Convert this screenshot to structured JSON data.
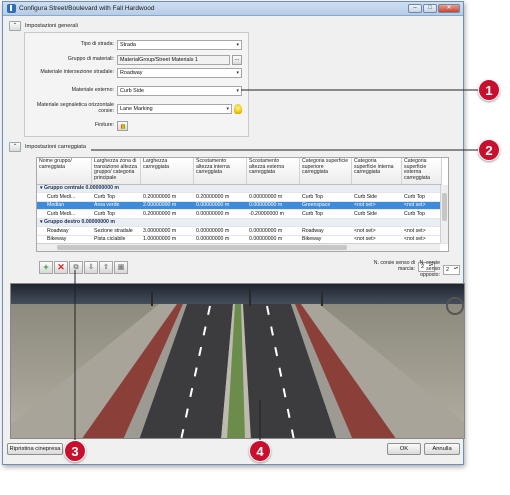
{
  "window": {
    "title": "Configura Street/Boulevard with Fall Hardwood",
    "minimize": "–",
    "maximize": "□",
    "close": "✕"
  },
  "general": {
    "header": "Impostazioni generali",
    "collapse_glyph": "⌃",
    "fields": [
      {
        "label": "Tipo di strada:",
        "value": "Strada"
      },
      {
        "label": "Gruppo di materiali:",
        "value": "MaterialGroup/Street Materials 1",
        "button": "..."
      },
      {
        "label": "Materiale intersezione stradale:",
        "value": "Roadway"
      },
      {
        "label": "Materiale esterno:",
        "value": "Curb Side"
      },
      {
        "label": "Materiale segnaletica orizzontale corsie:",
        "value": "Lane Marking"
      },
      {
        "label": "Finiture:",
        "value": ""
      }
    ]
  },
  "roadway": {
    "header": "Impostazioni carreggiata",
    "collapse_glyph": "⌃",
    "columns": [
      "Nome gruppo/ carreggiata",
      "Larghezza zona di transizione altezza gruppo/ categoria principale",
      "Larghezza carreggiata",
      "Scostamento altezza interna carreggiata",
      "Scostamento altezza esterna carreggiata",
      "Categoria superficie superiore carreggiata",
      "Categoria superficie interna carreggiata",
      "Categoria superficie esterna carreggiata"
    ],
    "rows": [
      {
        "type": "group",
        "text": "▾ Gruppo centrale  0.00000000 m"
      },
      {
        "type": "row",
        "cells": [
          "Curb Medi...",
          "Curb Top",
          "0.20000000 m",
          "0.20000000 m",
          "0.00000000 m",
          "Curb Top",
          "Curb Side",
          "Curb Top"
        ]
      },
      {
        "type": "sel",
        "cells": [
          "Median",
          "Area verde",
          "2.00000000 m",
          "0.00000000 m",
          "0.00000000 m",
          "Greenspace",
          "<not set>",
          "<not set>"
        ]
      },
      {
        "type": "row",
        "cells": [
          "Curb Medi...",
          "Curb Top",
          "0.20000000 m",
          "0.00000000 m",
          "-0.20000000 m",
          "Curb Top",
          "Curb Side",
          "Curb Top"
        ]
      },
      {
        "type": "group",
        "text": "▾ Gruppo destro  0.00000000 m"
      },
      {
        "type": "row",
        "cells": [
          "Roadway",
          "Sezione stradale",
          "3.00000000 m",
          "0.00000000 m",
          "0.00000000 m",
          "Roadway",
          "<not set>",
          "<not set>"
        ]
      },
      {
        "type": "row",
        "cells": [
          "Bikeway",
          "Pista ciclabile",
          "1.00000000 m",
          "0.00000000 m",
          "0.00000000 m",
          "Bikeway",
          "<not set>",
          "<not set>"
        ]
      }
    ],
    "toolbar": [
      {
        "icon": "add-row-icon",
        "glyph": "+",
        "cls": "add"
      },
      {
        "icon": "delete-row-icon",
        "glyph": "✕",
        "cls": "del"
      },
      {
        "icon": "duplicate-row-icon",
        "glyph": "⧉",
        "cls": "grey"
      },
      {
        "icon": "move-down-icon",
        "glyph": "⇩",
        "cls": "grey"
      },
      {
        "icon": "move-up-icon",
        "glyph": "⇧",
        "cls": "grey"
      },
      {
        "icon": "preview-icon",
        "glyph": "▣",
        "cls": "grey"
      }
    ],
    "lanes_forward_label": "N. corsie senso di marcia:",
    "lanes_forward_value": "2",
    "lanes_opposite_label": "N. corsie senso opposto:",
    "lanes_opposite_value": "2"
  },
  "footer": {
    "reset_camera": "Ripristina cinepresa",
    "ok": "OK",
    "cancel": "Annulla"
  },
  "callouts": [
    "1",
    "2",
    "3",
    "4"
  ],
  "colors": {
    "callout": "#c8102e",
    "selection": "#3d8bd9",
    "asphalt": "#3c3c3e",
    "grass": "#6b8c4a"
  }
}
